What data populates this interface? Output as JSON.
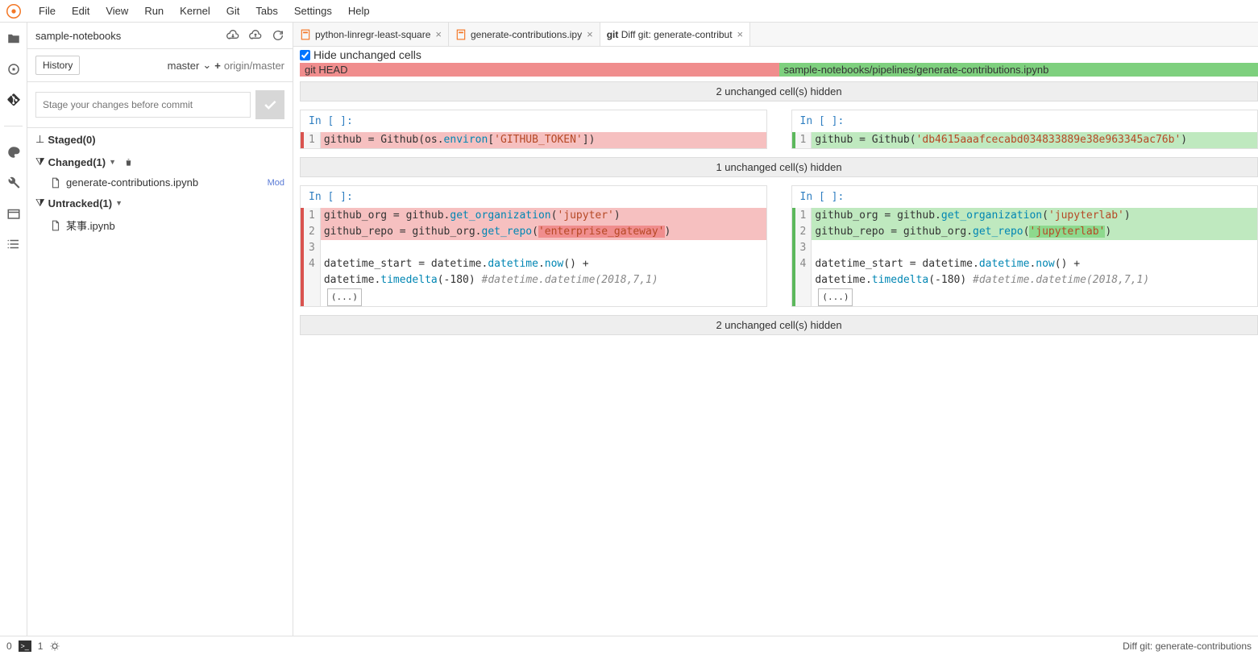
{
  "menubar": {
    "items": [
      "File",
      "Edit",
      "View",
      "Run",
      "Kernel",
      "Git",
      "Tabs",
      "Settings",
      "Help"
    ]
  },
  "sidebar": {
    "title": "sample-notebooks",
    "history_tab": "History",
    "branch_local": "master",
    "branch_remote": "origin/master",
    "commit_placeholder": "Stage your changes before commit",
    "staged_label": "Staged(0)",
    "changed_label": "Changed(1)",
    "untracked_label": "Untracked(1)",
    "changed_file": "generate-contributions.ipynb",
    "changed_badge": "Mod",
    "untracked_file": "某事.ipynb"
  },
  "tabs": {
    "t0": "python-linregr-least-square",
    "t1": "generate-contributions.ipy",
    "t2_prefix": "git",
    "t2": " Diff git: generate-contribut"
  },
  "diff": {
    "hide_label": "Hide unchanged cells",
    "left_banner": "git HEAD",
    "right_banner": "sample-notebooks/pipelines/generate-contributions.ipynb",
    "hidden2": "2 unchanged cell(s) hidden",
    "hidden1": "1 unchanged cell(s) hidden",
    "prompt": "In [ ]:",
    "cell1_left": {
      "ln": "1",
      "seg1": "github = Github(os.",
      "seg2": "environ",
      "seg3": "[",
      "seg4": "'GITHUB_TOKEN'",
      "seg5": "])"
    },
    "cell1_right": {
      "ln": "1",
      "seg1": "github = Github(",
      "seg2": "'db4615aaafcecabd034833889e38e963345ac76b'",
      "seg3": ")"
    },
    "cell2_left": {
      "l1a": "github_org = github.",
      "l1b": "get_organization",
      "l1c": "(",
      "l1d": "'jupyter'",
      "l1e": ")",
      "l2a": "github_repo = github_org.",
      "l2b": "get_repo",
      "l2c": "(",
      "l2d": "'enterprise_gateway'",
      "l2e": ")",
      "l4a": "datetime_start = datetime.",
      "l4b": "datetime",
      "l4c": ".",
      "l4d": "now",
      "l4e": "() + ",
      "l5a": "datetime.",
      "l5b": "timedelta",
      "l5c": "(-180) ",
      "l5d": "#datetime.datetime(2018,7,1)",
      "dots": "(...)"
    },
    "cell2_right": {
      "l1a": "github_org = github.",
      "l1b": "get_organization",
      "l1c": "(",
      "l1d": "'jupyterlab'",
      "l1e": ")",
      "l2a": "github_repo = github_org.",
      "l2b": "get_repo",
      "l2c": "(",
      "l2d": "'jupyterlab'",
      "l2e": ")",
      "l4a": "datetime_start = datetime.",
      "l4b": "datetime",
      "l4c": ".",
      "l4d": "now",
      "l4e": "() + ",
      "l5a": "datetime.",
      "l5b": "timedelta",
      "l5c": "(-180) ",
      "l5d": "#datetime.datetime(2018,7,1)",
      "dots": "(...)"
    },
    "ln1": "1",
    "ln2": "2",
    "ln3": "3",
    "ln4": "4"
  },
  "status": {
    "left0": "0",
    "left1": "1",
    "right": "Diff git: generate-contributions"
  }
}
